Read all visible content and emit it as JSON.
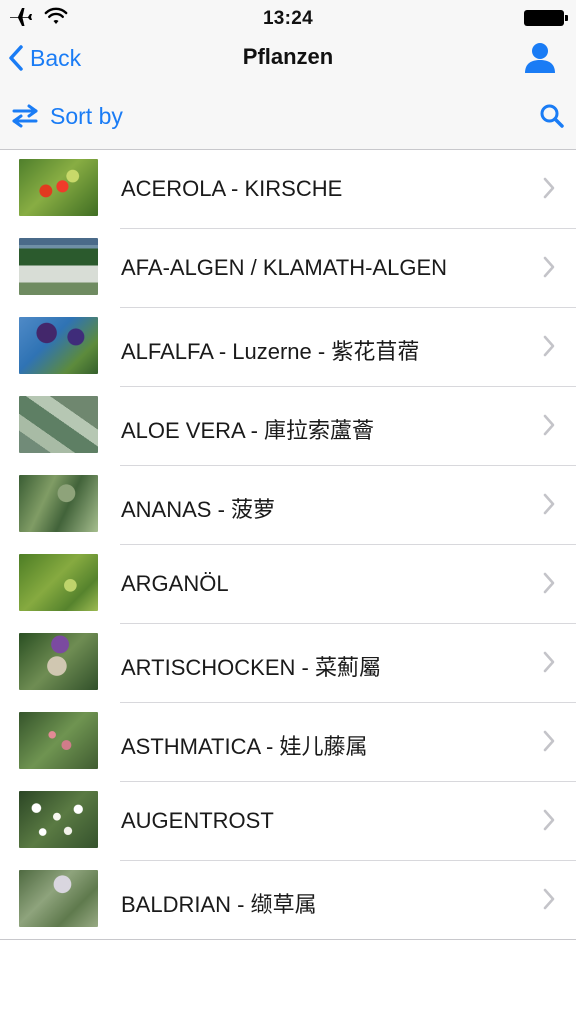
{
  "status_bar": {
    "time": "13:24",
    "icons": [
      "airplane-icon",
      "wifi-icon",
      "battery-icon"
    ]
  },
  "nav": {
    "back_label": "Back",
    "title": "Pflanzen",
    "right_icon": "user-icon"
  },
  "toolbar": {
    "sort_label": "Sort by",
    "sort_icon": "swap-arrows-icon",
    "search_icon": "search-icon"
  },
  "colors": {
    "accent": "#1a7cf5",
    "bar_background": "#f7f7f7",
    "separator": "#d8d8dc"
  },
  "plants": [
    {
      "label": "ACEROLA - KIRSCHE"
    },
    {
      "label": "AFA-ALGEN / KLAMATH-ALGEN"
    },
    {
      "label": "ALFALFA - Luzerne - 紫花苜蓿"
    },
    {
      "label": "ALOE VERA - 庫拉索蘆薈"
    },
    {
      "label": "ANANAS - 菠萝"
    },
    {
      "label": "ARGANÖL"
    },
    {
      "label": "ARTISCHOCKEN - 菜薊屬"
    },
    {
      "label": "ASTHMATICA - 娃儿藤属"
    },
    {
      "label": "AUGENTROST"
    },
    {
      "label": "BALDRIAN - 缬草属"
    }
  ]
}
